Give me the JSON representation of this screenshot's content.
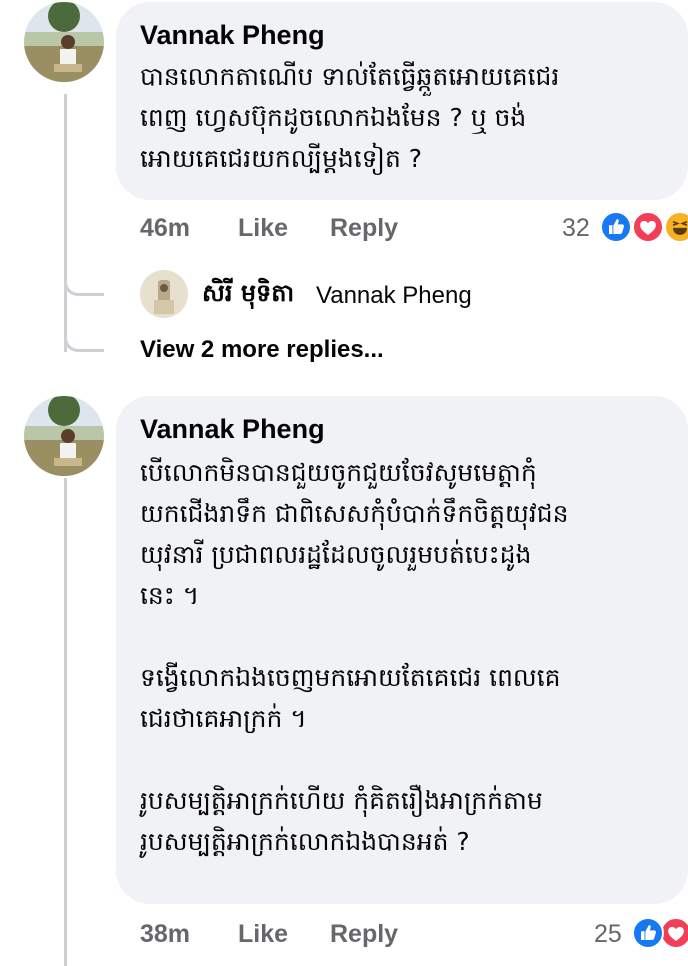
{
  "comments": [
    {
      "author": "Vannak Pheng",
      "text": "បានលោកតាណើប ទាល់តែធ្វើឆ្កួតអោយគេជេរ\nពេញ ហ្វេសប៊ុកដូចលោកឯងមែន ?  ឬ ចង់\nអោយគេជេរយកល្បីម្ដងទៀត ?",
      "time": "46m",
      "like_label": "Like",
      "reply_label": "Reply",
      "reaction_count": "32",
      "reactions": [
        "like-icon",
        "love-icon",
        "haha-icon"
      ]
    },
    {
      "author": "Vannak Pheng",
      "text": "បើលោកមិនបានជួយចូកជួយចែវសូមមេត្តាកុំ\nយកជើងរាទឹក ជាពិសេសកុំបំបាក់ទឹកចិត្តយុវជន\nយុវនារី ប្រជាពលរដ្ឋដែលចូលរួមបត់បេះដូង\nនេះ ។\n\nទង្វើលោកឯងចេញមកអោយតែគេជេរ ពេលគេ\nជេរថាគេអាក្រក់ ។\n\nរូបសម្បត្តិអាក្រក់ហើយ កុំគិតរឿងអាក្រក់តាម\nរូបសម្បត្តិអាក្រក់លោកឯងបានអត់ ?",
      "time": "38m",
      "like_label": "Like",
      "reply_label": "Reply",
      "reaction_count": "25",
      "reactions": [
        "like-icon",
        "love-icon"
      ]
    }
  ],
  "reply_preview": {
    "author": "សិរី មុទិតា",
    "text": "Vannak Pheng"
  },
  "view_more": "View 2 more replies...",
  "colors": {
    "bubble": "#f0f2f5",
    "meta": "#65676b",
    "thread_line": "#ced0d4",
    "like": "#1877f2",
    "love": "#f33e58",
    "haha": "#f7b125"
  }
}
